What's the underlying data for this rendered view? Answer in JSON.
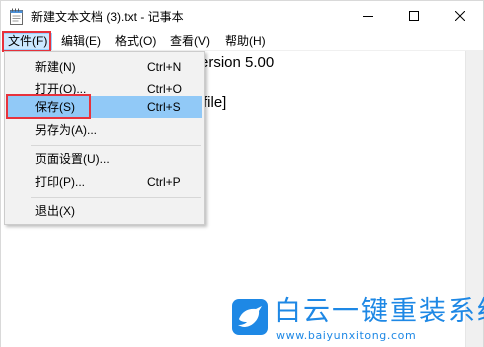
{
  "window": {
    "title": "新建文本文档 (3).txt - 记事本"
  },
  "icons": {
    "app": "notepad-icon",
    "minimize": "minimize-icon",
    "maximize": "maximize-icon",
    "close": "close-icon",
    "watermark": "bird-logo-icon"
  },
  "menubar": {
    "file": "文件(F)",
    "edit": "编辑(E)",
    "format": "格式(O)",
    "view": "查看(V)",
    "help": "帮助(H)"
  },
  "file_menu": {
    "items": [
      {
        "label": "新建(N)",
        "shortcut": "Ctrl+N"
      },
      {
        "label": "打开(O)...",
        "shortcut": "Ctrl+O"
      },
      {
        "label": "保存(S)",
        "shortcut": "Ctrl+S"
      },
      {
        "label": "另存为(A)...",
        "shortcut": ""
      },
      {
        "label": "页面设置(U)...",
        "shortcut": ""
      },
      {
        "label": "打印(P)...",
        "shortcut": "Ctrl+P"
      },
      {
        "label": "退出(X)",
        "shortcut": ""
      }
    ],
    "selected_index": 2
  },
  "editor": {
    "line1": "ersion 5.00",
    "line2": "file]"
  },
  "watermark": {
    "title": "白云一键重装系统",
    "url": "www.baiyunxitong.com"
  },
  "colors": {
    "highlight": "#e8323c",
    "selected": "#91c9f7",
    "brand": "#1e88e5"
  }
}
